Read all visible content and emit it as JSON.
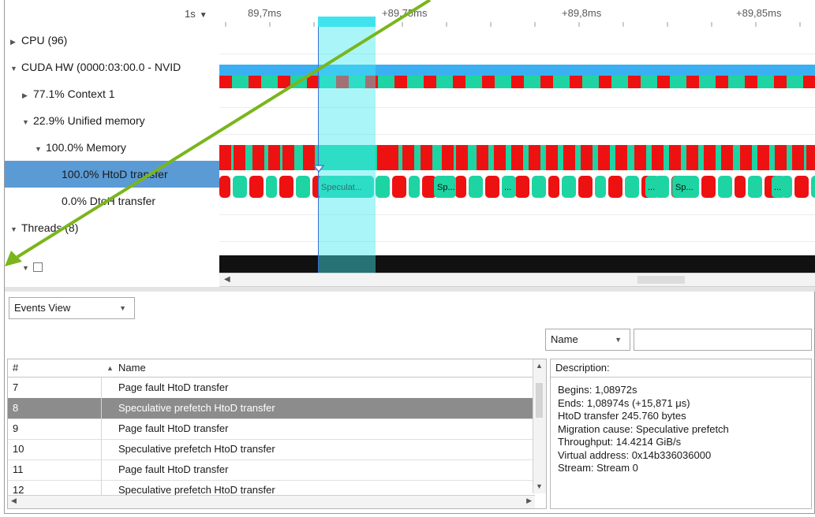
{
  "timeline": {
    "zoom": "1s",
    "ticks": [
      "89,7ms",
      "+89,75ms",
      "+89,8ms",
      "+89,85ms"
    ],
    "rows": [
      {
        "label": "CPU (96)",
        "expander": "collapsed"
      },
      {
        "label": "CUDA HW (0000:03:00.0 - NVID",
        "expander": "expanded"
      },
      {
        "label": "77.1% Context 1",
        "expander": "collapsed"
      },
      {
        "label": "22.9% Unified memory",
        "expander": "expanded"
      },
      {
        "label": "100.0% Memory",
        "expander": "expanded"
      },
      {
        "label": "100.0% HtoD transfer",
        "expander": "none",
        "selected": true
      },
      {
        "label": "0.0% DtoH transfer",
        "expander": "none"
      },
      {
        "label": "Threads (8)",
        "expander": "expanded"
      }
    ],
    "event_labels": [
      "Speculat...",
      "Sp...",
      "...",
      "Sp..."
    ],
    "colors": {
      "transfer_teal": "#1ed4a2",
      "fault_red": "#ee1111",
      "cuda_blue": "#3ab0f2",
      "selection": "#43e8f0",
      "row_selected": "#5b9bd5",
      "thread_bar": "#111111",
      "arrow": "#7ab51d"
    }
  },
  "events_view": {
    "selector_label": "Events View",
    "filter_field": "Name",
    "filter_value": "",
    "columns": {
      "index": "#",
      "name": "Name"
    },
    "rows": [
      {
        "n": "7",
        "name": "Page fault HtoD transfer"
      },
      {
        "n": "8",
        "name": "Speculative prefetch HtoD transfer"
      },
      {
        "n": "9",
        "name": "Page fault HtoD transfer"
      },
      {
        "n": "10",
        "name": "Speculative prefetch HtoD transfer"
      },
      {
        "n": "11",
        "name": "Page fault HtoD transfer"
      },
      {
        "n": "12",
        "name": "Speculative prefetch HtoD transfer"
      }
    ],
    "selected_row": "8"
  },
  "description": {
    "header": "Description:",
    "lines": [
      "Begins: 1,08972s",
      "Ends: 1,08974s (+15,871 μs)",
      "HtoD transfer 245.760 bytes",
      "Migration cause: Speculative prefetch",
      "Throughput: 14.4214 GiB/s",
      "Virtual address: 0x14b336036000",
      "Stream: Stream 0"
    ]
  }
}
